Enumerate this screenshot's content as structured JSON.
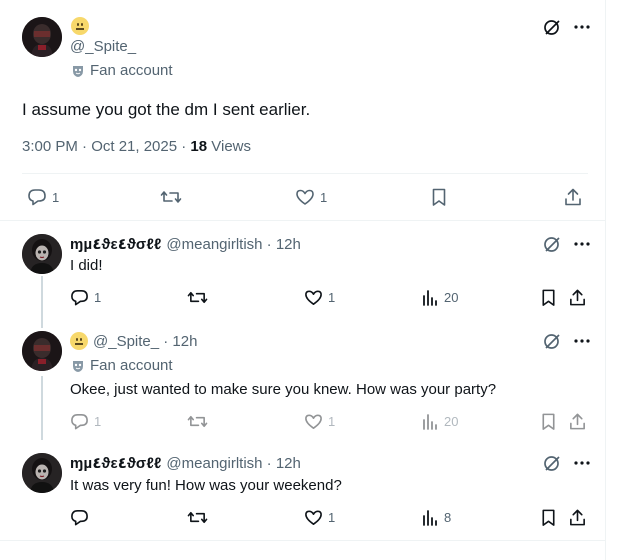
{
  "colors": {
    "text": "#0f1419",
    "muted": "#536471",
    "border": "#eff3f4",
    "thread": "#cfd9de",
    "emoji": "#f7d86b"
  },
  "main_post": {
    "avatar_icon": "goth-doll-avatar",
    "emoji_icon": "neutral-face-emoji",
    "handle": "@_Spite_",
    "label_icon": "mask-icon",
    "label": "Fan account",
    "text": "I assume you got the dm I sent earlier.",
    "time": "3:00 PM · Oct 21, 2025 · ",
    "views_count": "18",
    "views_label": " Views",
    "actions": {
      "reply_count": "1",
      "repost_count": "",
      "like_count": "1"
    }
  },
  "replies": [
    {
      "display_name": "ɱµ٤ϑε٤ϑσℓℓ",
      "handle": "@meangirltish · 12h",
      "text": "I did!",
      "actions": {
        "reply_count": "1",
        "like_count": "1",
        "views_count": "20"
      }
    },
    {
      "emoji_icon": "neutral-face-emoji",
      "handle": "@_Spite_ · 12h",
      "label": "Fan account",
      "text": "Okee, just wanted to make sure you knew. How was your party?",
      "actions": {
        "reply_count": "1",
        "like_count": "1",
        "views_count": "20"
      }
    },
    {
      "display_name": "ɱµ٤ϑε٤ϑσℓℓ",
      "handle": "@meangirltish · 12h",
      "text": "It was very fun! How was your weekend?",
      "actions": {
        "reply_count": "",
        "like_count": "1",
        "views_count": "8"
      }
    }
  ]
}
